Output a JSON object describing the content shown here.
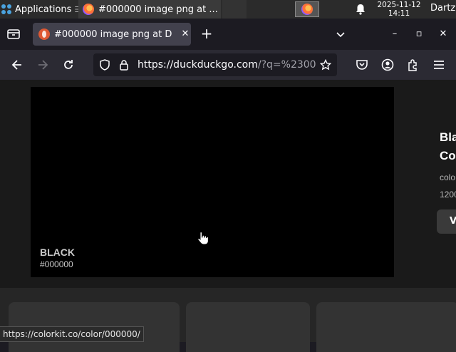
{
  "taskbar": {
    "apps_label": "Applications",
    "task_title": "#000000 image png at ...",
    "clock_date": "2025-11-12",
    "clock_time": "14:11",
    "user": "Dartz"
  },
  "browser": {
    "tab_title": "#000000 image png at D",
    "url_host": "https://duckduckgo.com",
    "url_path": "/?q=%2300",
    "tab_close": "✕",
    "new_tab": "+",
    "win_min": "–",
    "win_max": "▫",
    "win_close": "✕"
  },
  "content": {
    "color_name": "BLACK",
    "color_hex": "#000000",
    "side_title_1": "Bla",
    "side_title_2": "Co",
    "side_meta_1": "colo",
    "side_meta_2": "1200",
    "side_button": "V"
  },
  "status": {
    "link_url": "https://colorkit.co/color/000000/"
  },
  "colors": {
    "accent": "#de5833",
    "preview": "#000000"
  }
}
